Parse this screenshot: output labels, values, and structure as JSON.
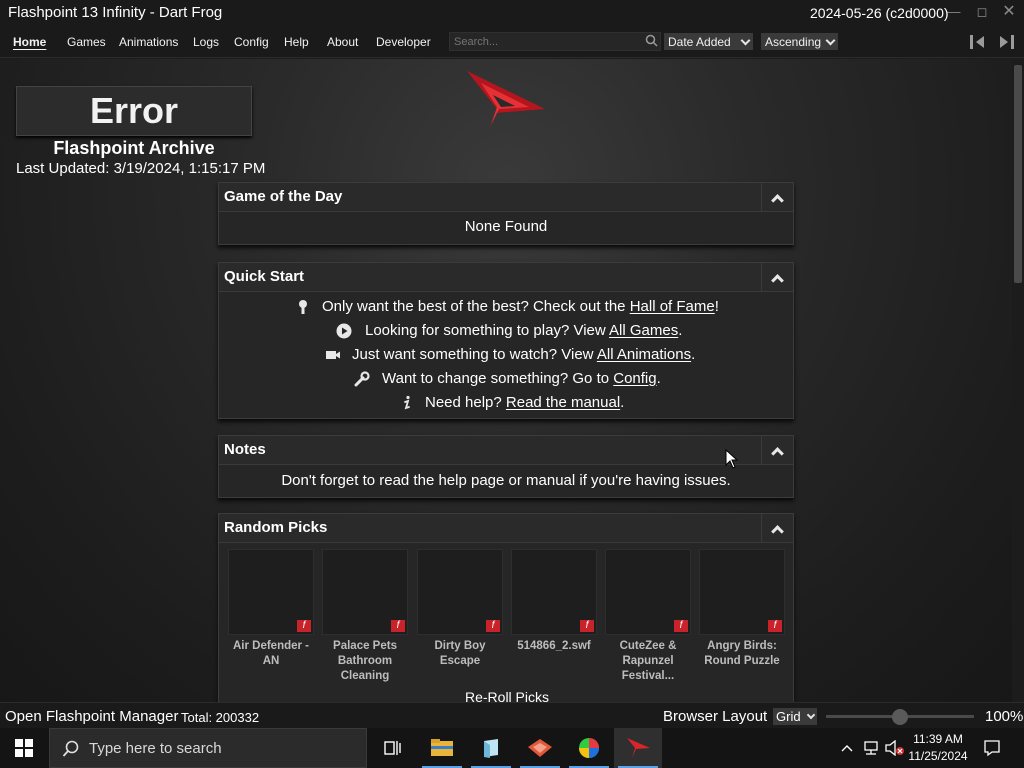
{
  "window": {
    "title": "Flashpoint 13 Infinity - Dart Frog",
    "version": "2024-05-26 (c2d0000)"
  },
  "menu": {
    "items": [
      "Home",
      "Games",
      "Animations",
      "Logs",
      "Config",
      "Help",
      "About",
      "Developer"
    ],
    "search_placeholder": "Search...",
    "sort_field": "Date Added",
    "sort_order": "Ascending"
  },
  "home": {
    "error_title": "Error",
    "archive_name": "Flashpoint Archive",
    "last_updated": "Last Updated: 3/19/2024, 1:15:17 PM",
    "game_of_the_day": {
      "title": "Game of the Day",
      "body": "None Found"
    },
    "quick_start": {
      "title": "Quick Start",
      "lines": [
        {
          "icon": "trophy-icon",
          "before": "Only want the best of the best? Check out the ",
          "link": "Hall of Fame",
          "after": "!"
        },
        {
          "icon": "play-circle-icon",
          "before": "Looking for something to play? View ",
          "link": "All Games",
          "after": "."
        },
        {
          "icon": "video-camera-icon",
          "before": "Just want something to watch? View ",
          "link": "All Animations",
          "after": "."
        },
        {
          "icon": "wrench-icon",
          "before": "Want to change something? Go to ",
          "link": "Config",
          "after": "."
        },
        {
          "icon": "info-icon",
          "before": "Need help? ",
          "link": "Read the manual",
          "after": "."
        }
      ]
    },
    "notes": {
      "title": "Notes",
      "body": "Don't forget to read the help page or manual if you're having issues."
    },
    "random_picks": {
      "title": "Random Picks",
      "items": [
        {
          "title": "Air Defender - AN",
          "platform_icon": "flash-icon"
        },
        {
          "title": "Palace Pets Bathroom Cleaning",
          "platform_icon": "flash-icon"
        },
        {
          "title": "Dirty Boy Escape",
          "platform_icon": "flash-icon"
        },
        {
          "title": "514866_2.swf",
          "platform_icon": "flash-icon"
        },
        {
          "title": "CuteZee & Rapunzel Festival...",
          "platform_icon": "flash-icon"
        },
        {
          "title": "Angry Birds: Round Puzzle",
          "platform_icon": "flash-icon"
        }
      ],
      "reroll_label": "Re-Roll Picks"
    }
  },
  "statusbar": {
    "manager_label": "Open Flashpoint Manager",
    "total": "Total: 200332",
    "layout_label": "Browser Layout",
    "layout_value": "Grid",
    "zoom": "100%",
    "zoom_level": 0.5
  },
  "taskbar": {
    "search_placeholder": "Type here to search",
    "time": "11:39 AM",
    "date": "11/25/2024",
    "apps": [
      "task-view-icon",
      "file-explorer-icon",
      "notepad-icon",
      "game-app-icon",
      "color-wheel-app-icon",
      "flashpoint-launcher-icon"
    ]
  },
  "colors": {
    "accent_red": "#c8232a",
    "taskbar_indicator": "#5aa2e8"
  }
}
